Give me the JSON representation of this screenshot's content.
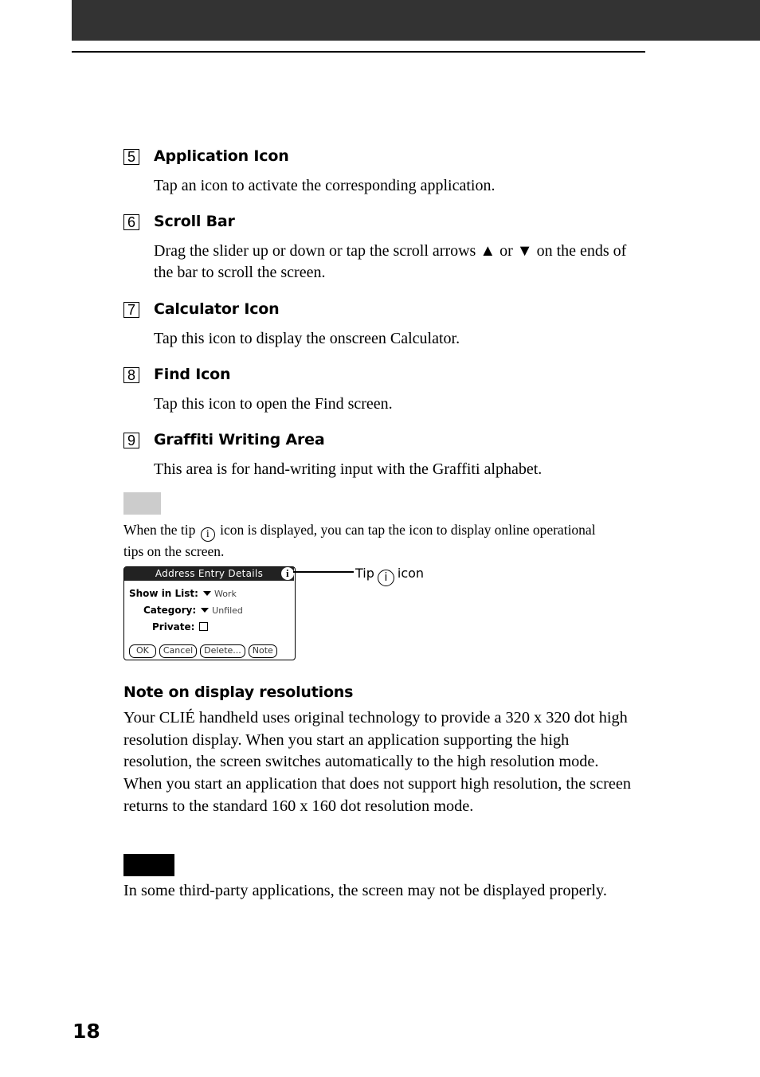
{
  "header": {
    "bar_color": "#333333"
  },
  "items": [
    {
      "number": "5",
      "title": "Application Icon",
      "description": "Tap an icon to activate the corresponding application."
    },
    {
      "number": "6",
      "title": "Scroll Bar",
      "description": "Drag the slider up or down or tap the scroll arrows ▲ or ▼ on the ends of the bar to scroll the screen."
    },
    {
      "number": "7",
      "title": "Calculator Icon",
      "description": "Tap this icon to display the onscreen Calculator."
    },
    {
      "number": "8",
      "title": "Find Icon",
      "description": "Tap this icon to open the Find screen."
    },
    {
      "number": "9",
      "title": "Graffiti Writing Area",
      "description": "This area is for hand-writing input with the Graffiti alphabet."
    }
  ],
  "tip": {
    "text_before": "When the tip",
    "icon_glyph": "i",
    "text_after": "icon is displayed, you can tap the icon to display online operational tips on the screen."
  },
  "dialog": {
    "title": "Address Entry Details",
    "info_glyph": "i",
    "fields": [
      {
        "label": "Show in List:",
        "value": "Work"
      },
      {
        "label": "Category:",
        "value": "Unfiled"
      },
      {
        "label": "Private:",
        "checked": false
      }
    ],
    "buttons": [
      "OK",
      "Cancel",
      "Delete...",
      "Note"
    ]
  },
  "callout": {
    "prefix": "Tip",
    "icon_glyph": "i",
    "suffix": "icon"
  },
  "note_section": {
    "heading": "Note on display resolutions",
    "body": "Your CLIÉ handheld uses original technology to provide a 320 x 320 dot high resolution display. When you start an application supporting the high resolution, the screen switches automatically to the high resolution mode. When you start an application that does not support high resolution, the screen returns to the standard 160 x 160 dot resolution mode."
  },
  "note2": {
    "body": "In some third-party applications, the screen may not be displayed properly."
  },
  "page_number": "18"
}
